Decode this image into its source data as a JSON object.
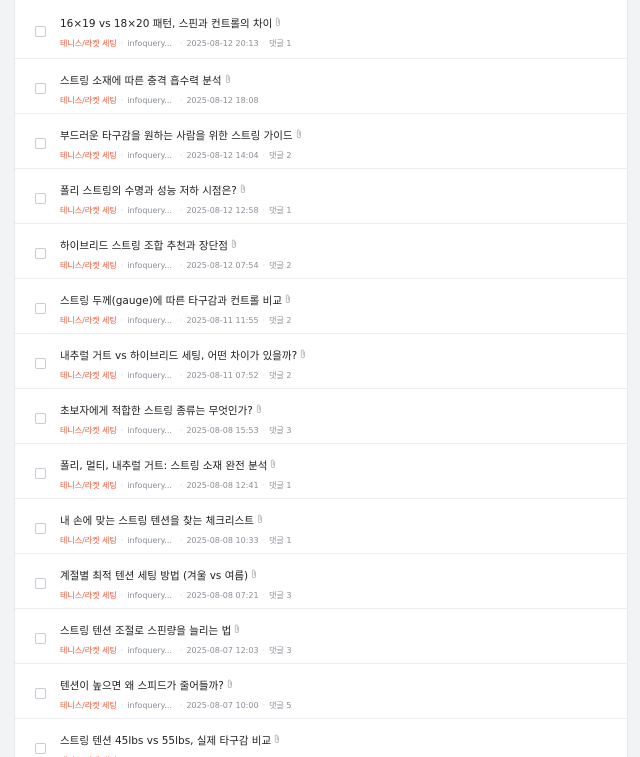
{
  "posts": [
    {
      "title": "16×19 vs 18×20 패턴, 스핀과 컨트롤의 차이",
      "category": "테니스/라켓 세팅",
      "author": "infoquery...",
      "date": "2025-08-12 20:13",
      "comments": "댓글 1"
    },
    {
      "title": "스트링 소재에 따른 충격 흡수력 분석",
      "category": "테니스/라켓 세팅",
      "author": "infoquery...",
      "date": "2025-08-12 18:08",
      "comments": ""
    },
    {
      "title": "부드러운 타구감을 원하는 사람을 위한 스트링 가이드",
      "category": "테니스/라켓 세팅",
      "author": "infoquery...",
      "date": "2025-08-12 14:04",
      "comments": "댓글 2"
    },
    {
      "title": "폴리 스트링의 수명과 성능 저하 시점은?",
      "category": "테니스/라켓 세팅",
      "author": "infoquery...",
      "date": "2025-08-12 12:58",
      "comments": "댓글 1"
    },
    {
      "title": "하이브리드 스트링 조합 추천과 장단점",
      "category": "테니스/라켓 세팅",
      "author": "infoquery...",
      "date": "2025-08-12 07:54",
      "comments": "댓글 2"
    },
    {
      "title": "스트링 두께(gauge)에 따른 타구감과 컨트롤 비교",
      "category": "테니스/라켓 세팅",
      "author": "infoquery...",
      "date": "2025-08-11 11:55",
      "comments": "댓글 2"
    },
    {
      "title": "내추럴 거트 vs 하이브리드 세팅, 어떤 차이가 있을까?",
      "category": "테니스/라켓 세팅",
      "author": "infoquery...",
      "date": "2025-08-11 07:52",
      "comments": "댓글 2"
    },
    {
      "title": "초보자에게 적합한 스트링 종류는 무엇인가?",
      "category": "테니스/라켓 세팅",
      "author": "infoquery...",
      "date": "2025-08-08 15:53",
      "comments": "댓글 3"
    },
    {
      "title": "폴리, 멀티, 내추럴 거트: 스트링 소재 완전 분석",
      "category": "테니스/라켓 세팅",
      "author": "infoquery...",
      "date": "2025-08-08 12:41",
      "comments": "댓글 1"
    },
    {
      "title": "내 손에 맞는 스트링 텐션을 찾는 체크리스트",
      "category": "테니스/라켓 세팅",
      "author": "infoquery...",
      "date": "2025-08-08 10:33",
      "comments": "댓글 1"
    },
    {
      "title": "계절별 최적 텐션 세팅 방법 (겨울 vs 여름)",
      "category": "테니스/라켓 세팅",
      "author": "infoquery...",
      "date": "2025-08-08 07:21",
      "comments": "댓글 3"
    },
    {
      "title": "스트링 텐션 조절로 스핀량을 늘리는 법",
      "category": "테니스/라켓 세팅",
      "author": "infoquery...",
      "date": "2025-08-07 12:03",
      "comments": "댓글 3"
    },
    {
      "title": "텐션이 높으면 왜 스피드가 줄어들까?",
      "category": "테니스/라켓 세팅",
      "author": "infoquery...",
      "date": "2025-08-07 10:00",
      "comments": "댓글 5"
    },
    {
      "title": "스트링 텐션 45lbs vs 55lbs, 실제 타구감 비교",
      "category": "테니스/라켓 세팅",
      "author": "infoquery...",
      "date": "",
      "comments": ""
    }
  ]
}
